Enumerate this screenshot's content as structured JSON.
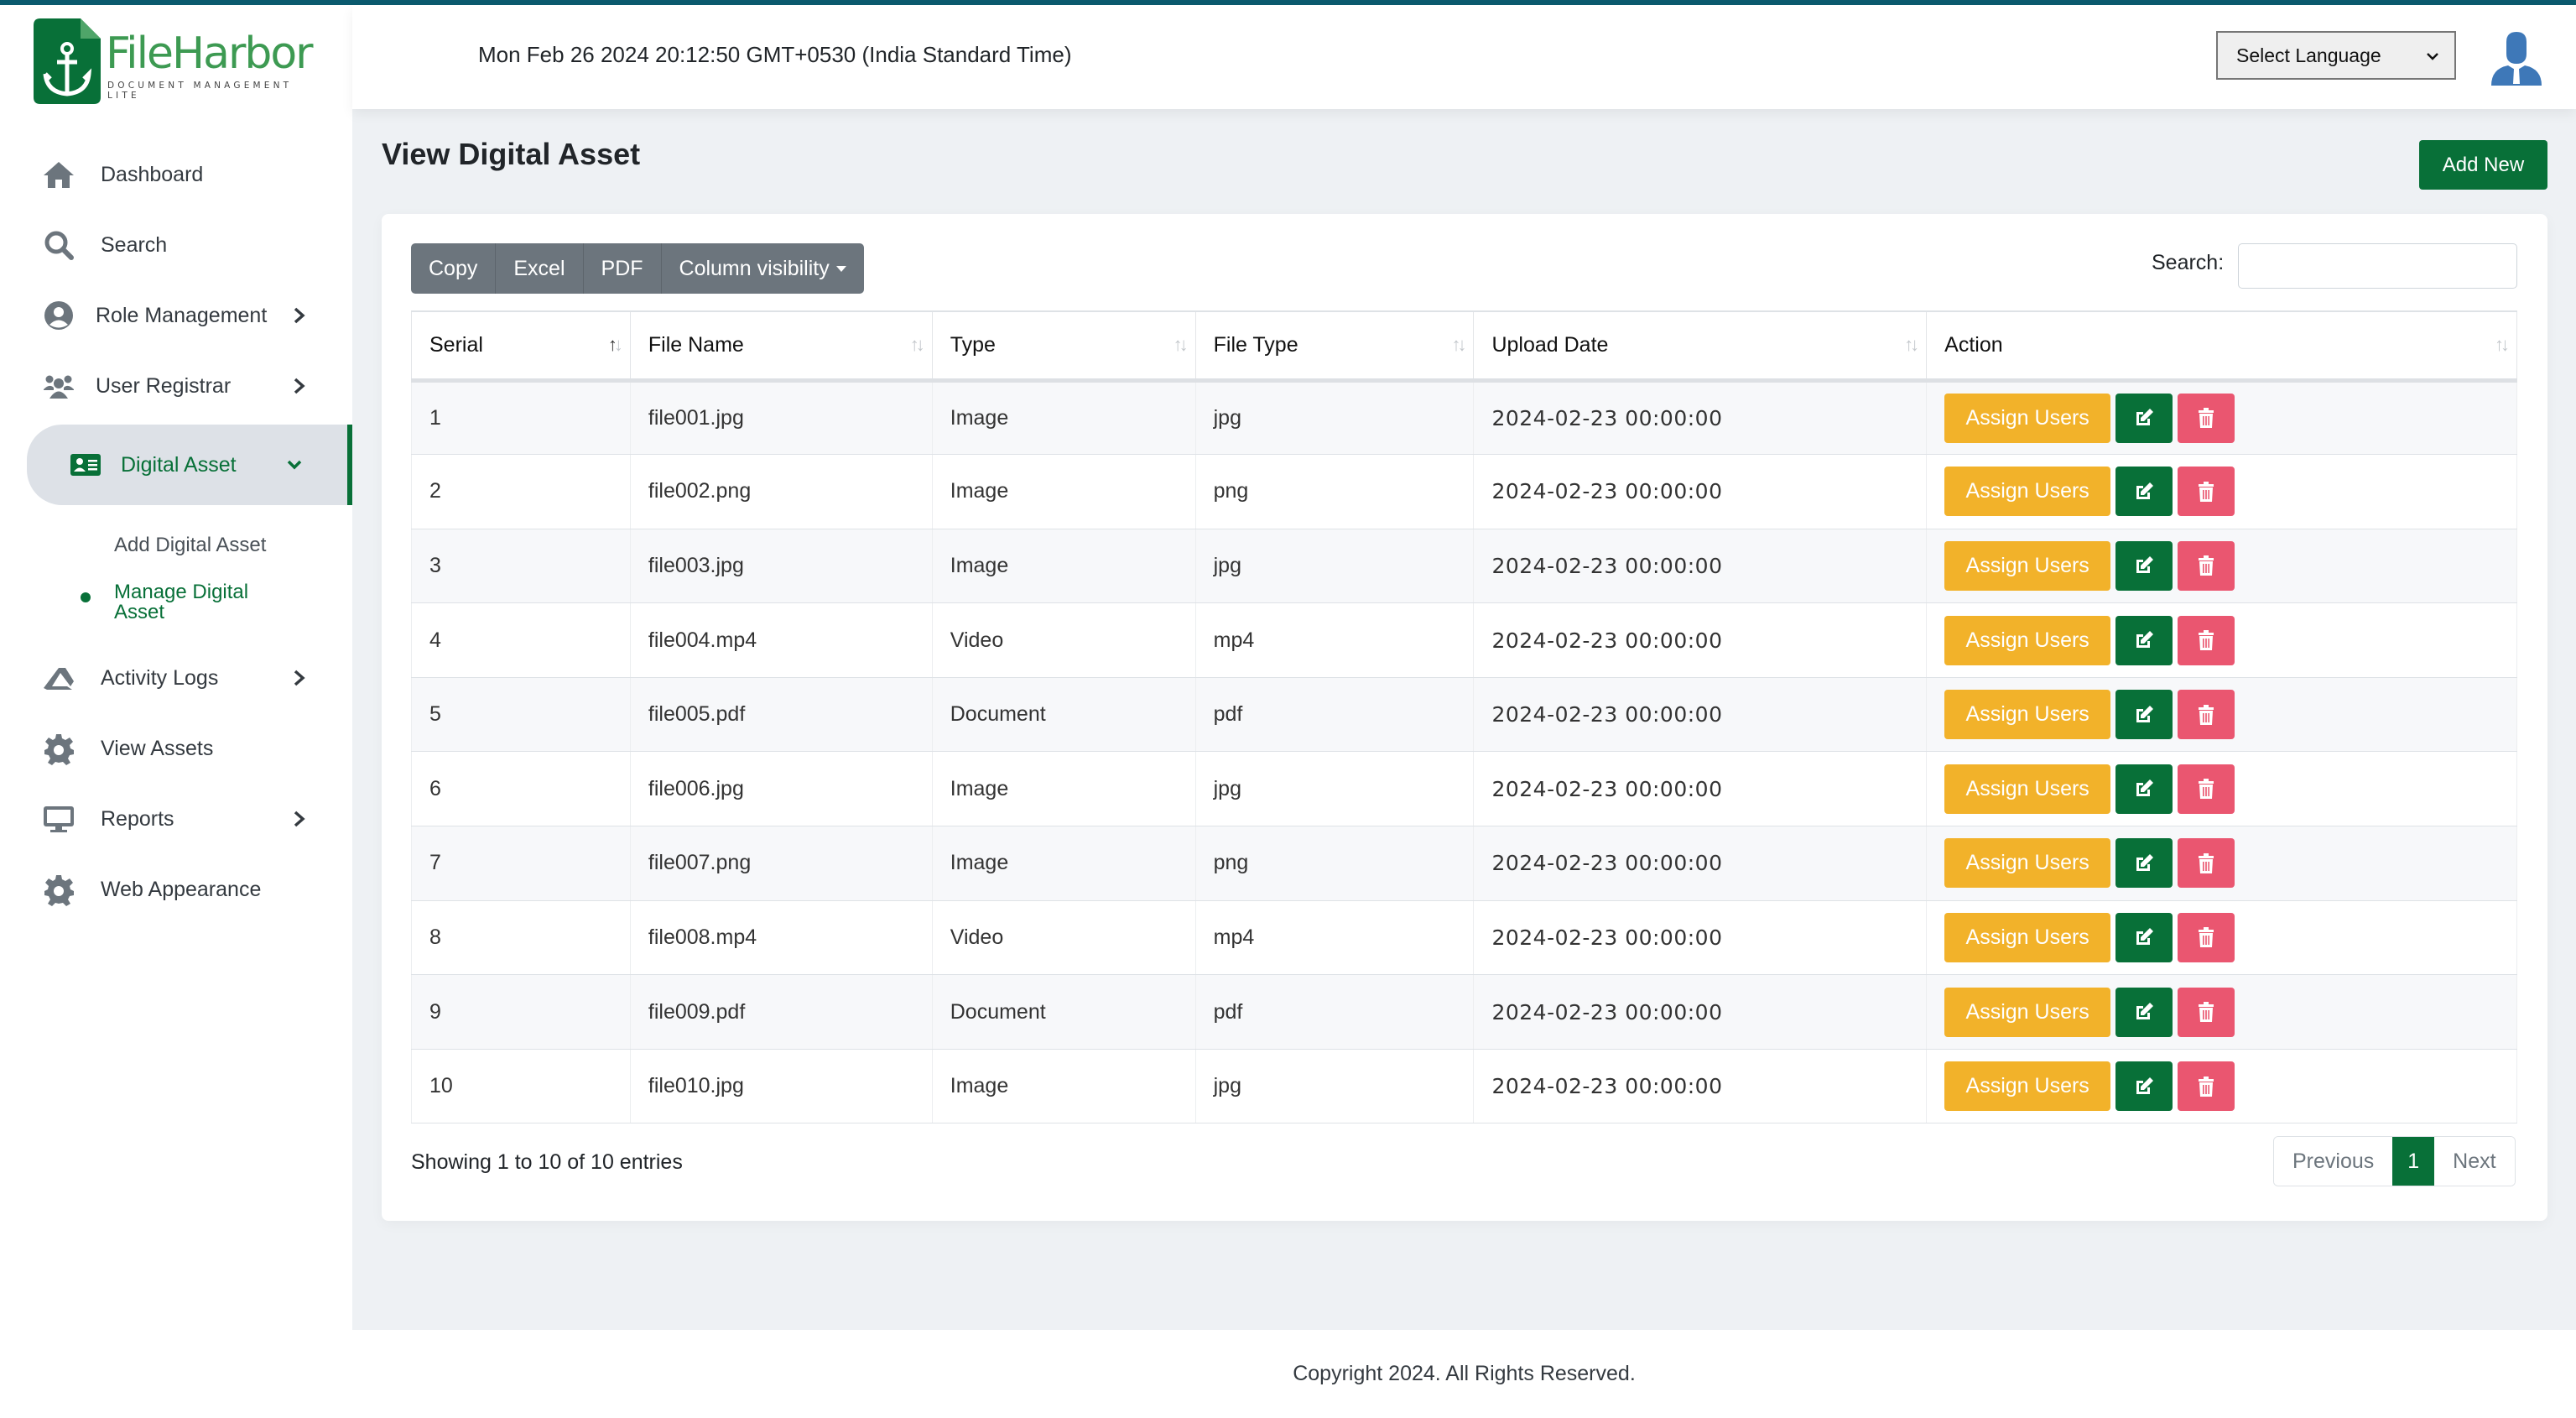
{
  "brand": {
    "name": "FileHarbor",
    "tagline": "DOCUMENT MANAGEMENT LITE",
    "accent_color": "#087038",
    "topbar_color": "#0b5a6e"
  },
  "header": {
    "datetime": "Mon Feb 26 2024 20:12:50 GMT+0530 (India Standard Time)",
    "language_select": "Select Language",
    "avatar_icon": "user-avatar-icon"
  },
  "sidebar": {
    "items": [
      {
        "label": "Dashboard",
        "icon": "home-icon",
        "has_children": false
      },
      {
        "label": "Search",
        "icon": "search-icon",
        "has_children": false
      },
      {
        "label": "Role Management",
        "icon": "user-circle-icon",
        "has_children": true
      },
      {
        "label": "User Registrar",
        "icon": "users-icon",
        "has_children": true
      },
      {
        "label": "Digital Asset",
        "icon": "id-card-icon",
        "has_children": true,
        "active": true,
        "expanded": true
      },
      {
        "label": "Activity Logs",
        "icon": "activity-icon",
        "has_children": true
      },
      {
        "label": "View Assets",
        "icon": "gear-icon",
        "has_children": false
      },
      {
        "label": "Reports",
        "icon": "monitor-icon",
        "has_children": true
      },
      {
        "label": "Web Appearance",
        "icon": "gear-icon",
        "has_children": false
      }
    ],
    "sub_items": [
      {
        "label": "Add Digital Asset",
        "active": false
      },
      {
        "label": "Manage Digital Asset",
        "active": true
      }
    ]
  },
  "main": {
    "title": "View Digital Asset",
    "add_new_label": "Add New",
    "toolbar": {
      "copy": "Copy",
      "excel": "Excel",
      "pdf": "PDF",
      "column_visibility": "Column visibility"
    },
    "search": {
      "label": "Search:",
      "value": "",
      "placeholder": ""
    },
    "table": {
      "columns": [
        "Serial",
        "File Name",
        "Type",
        "File Type",
        "Upload Date",
        "Action"
      ],
      "sorted_column": "Serial",
      "rows": [
        {
          "serial": "1",
          "file_name": "file001.jpg",
          "type": "Image",
          "file_type": "jpg",
          "upload_date": "2024-02-23 00:00:00"
        },
        {
          "serial": "2",
          "file_name": "file002.png",
          "type": "Image",
          "file_type": "png",
          "upload_date": "2024-02-23 00:00:00"
        },
        {
          "serial": "3",
          "file_name": "file003.jpg",
          "type": "Image",
          "file_type": "jpg",
          "upload_date": "2024-02-23 00:00:00"
        },
        {
          "serial": "4",
          "file_name": "file004.mp4",
          "type": "Video",
          "file_type": "mp4",
          "upload_date": "2024-02-23 00:00:00"
        },
        {
          "serial": "5",
          "file_name": "file005.pdf",
          "type": "Document",
          "file_type": "pdf",
          "upload_date": "2024-02-23 00:00:00"
        },
        {
          "serial": "6",
          "file_name": "file006.jpg",
          "type": "Image",
          "file_type": "jpg",
          "upload_date": "2024-02-23 00:00:00"
        },
        {
          "serial": "7",
          "file_name": "file007.png",
          "type": "Image",
          "file_type": "png",
          "upload_date": "2024-02-23 00:00:00"
        },
        {
          "serial": "8",
          "file_name": "file008.mp4",
          "type": "Video",
          "file_type": "mp4",
          "upload_date": "2024-02-23 00:00:00"
        },
        {
          "serial": "9",
          "file_name": "file009.pdf",
          "type": "Document",
          "file_type": "pdf",
          "upload_date": "2024-02-23 00:00:00"
        },
        {
          "serial": "10",
          "file_name": "file010.jpg",
          "type": "Image",
          "file_type": "jpg",
          "upload_date": "2024-02-23 00:00:00"
        }
      ],
      "action_labels": {
        "assign": "Assign Users",
        "edit_icon": "edit-icon",
        "delete_icon": "trash-icon"
      }
    },
    "info": "Showing 1 to 10 of 10 entries",
    "pagination": {
      "previous": "Previous",
      "current": "1",
      "next": "Next"
    }
  },
  "footer": {
    "text": "Copyright 2024. All Rights Reserved."
  }
}
